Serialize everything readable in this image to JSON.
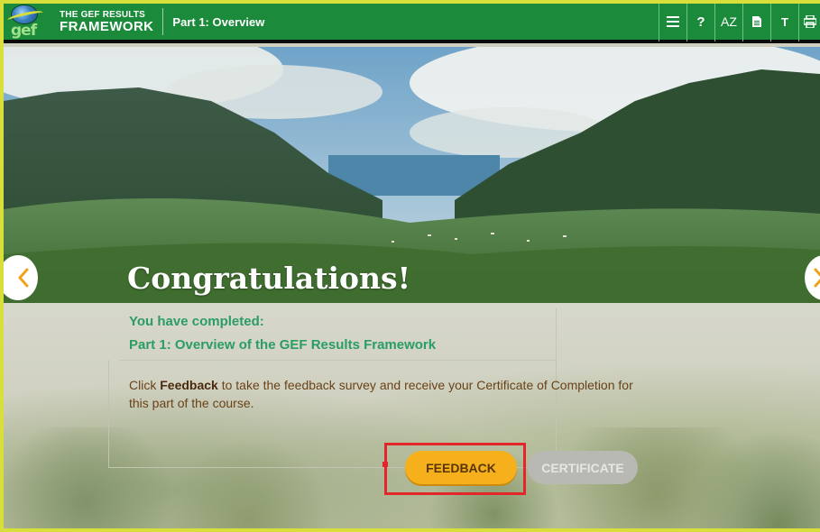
{
  "header": {
    "logo_text": "gef",
    "brand_line1": "THE GEF RESULTS",
    "brand_line2": "FRAMEWORK",
    "section_title": "Part 1: Overview",
    "tools": [
      {
        "icon": "menu-icon"
      },
      {
        "icon": "help-icon",
        "label": "?"
      },
      {
        "icon": "glossary-icon",
        "label": "AZ"
      },
      {
        "icon": "resources-icon"
      },
      {
        "icon": "transcript-icon",
        "label": "T"
      },
      {
        "icon": "print-icon"
      }
    ]
  },
  "hero": {
    "heading": "Congratulations!"
  },
  "completion": {
    "line1": "You have completed:",
    "line2": "Part 1: Overview of the GEF Results Framework"
  },
  "instructions": {
    "prefix": "Click ",
    "bold": "Feedback",
    "suffix": " to take the feedback survey and receive your Certificate of Completion for this part of the course."
  },
  "buttons": {
    "feedback": "FEEDBACK",
    "certificate": "CERTIFICATE"
  },
  "colors": {
    "header_green": "#1b8a3a",
    "frame_yellow": "#d9df3a",
    "completion_green": "#2a9d63",
    "feedback_orange": "#f5b01c",
    "highlight_red": "#e3262a"
  }
}
